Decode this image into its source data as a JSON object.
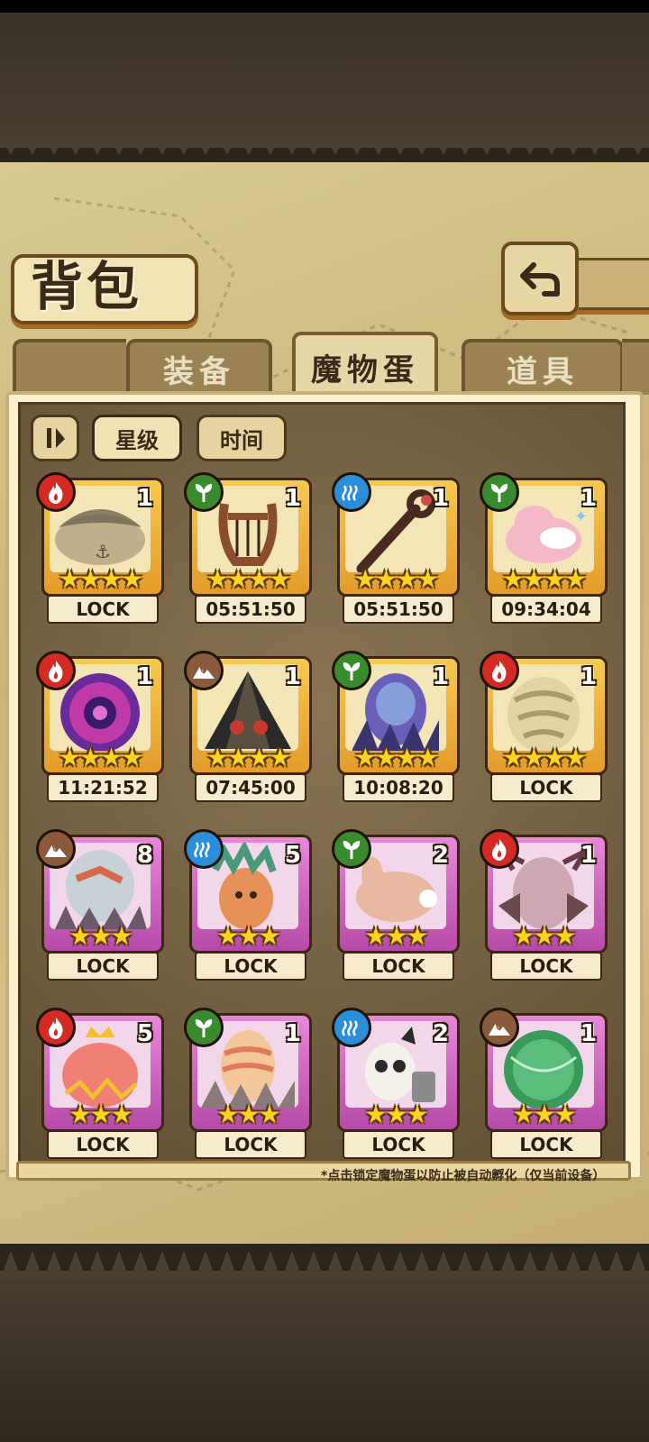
{
  "screen": {
    "title": "背包"
  },
  "tabs": [
    {
      "label": "装备",
      "active": false
    },
    {
      "label": "魔物蛋",
      "active": true
    },
    {
      "label": "道具",
      "active": false
    }
  ],
  "sort": {
    "star_label": "星级",
    "time_label": "时间",
    "selected": "星级"
  },
  "eggs": [
    {
      "element": "fire",
      "count": "1",
      "stars": 4,
      "status": "LOCK",
      "rarity": "gold",
      "art": "pirate-hat"
    },
    {
      "element": "grass",
      "count": "1",
      "stars": 4,
      "status": "05:51:50",
      "rarity": "gold",
      "art": "lyre"
    },
    {
      "element": "water",
      "count": "1",
      "stars": 4,
      "status": "05:51:50",
      "rarity": "gold",
      "art": "staff"
    },
    {
      "element": "grass",
      "count": "1",
      "stars": 4,
      "status": "09:34:04",
      "rarity": "gold",
      "art": "pink-creature"
    },
    {
      "element": "fire",
      "count": "1",
      "stars": 4,
      "status": "11:21:52",
      "rarity": "gold",
      "art": "purple-orb"
    },
    {
      "element": "earth",
      "count": "1",
      "stars": 4,
      "status": "07:45:00",
      "rarity": "gold",
      "art": "pyramid"
    },
    {
      "element": "grass",
      "count": "1",
      "stars": 4,
      "status": "10:08:20",
      "rarity": "gold",
      "art": "crystal-egg"
    },
    {
      "element": "fire",
      "count": "1",
      "stars": 4,
      "status": "LOCK",
      "rarity": "gold",
      "art": "tiger-egg"
    },
    {
      "element": "earth",
      "count": "8",
      "stars": 3,
      "status": "LOCK",
      "rarity": "pink",
      "art": "nest-egg"
    },
    {
      "element": "water",
      "count": "5",
      "stars": 3,
      "status": "LOCK",
      "rarity": "pink",
      "art": "feather-egg"
    },
    {
      "element": "grass",
      "count": "2",
      "stars": 3,
      "status": "LOCK",
      "rarity": "pink",
      "art": "bunny-egg"
    },
    {
      "element": "fire",
      "count": "1",
      "stars": 3,
      "status": "LOCK",
      "rarity": "pink",
      "art": "demon-egg"
    },
    {
      "element": "fire",
      "count": "5",
      "stars": 3,
      "status": "LOCK",
      "rarity": "pink",
      "art": "crown-egg"
    },
    {
      "element": "grass",
      "count": "1",
      "stars": 3,
      "status": "LOCK",
      "rarity": "pink",
      "art": "striped-egg"
    },
    {
      "element": "water",
      "count": "2",
      "stars": 3,
      "status": "LOCK",
      "rarity": "pink",
      "art": "panda-egg"
    },
    {
      "element": "earth",
      "count": "1",
      "stars": 3,
      "status": "LOCK",
      "rarity": "pink",
      "art": "green-orb"
    }
  ],
  "footnote": "*点击锁定魔物蛋以防止被自动孵化（仅当前设备）",
  "colors": {
    "gold_frame": "#f2b73a",
    "pink_frame": "#d668c8",
    "fire": "#d52a23",
    "grass": "#3a8a2e",
    "water": "#2a8fd8",
    "earth": "#8a5a3a"
  }
}
